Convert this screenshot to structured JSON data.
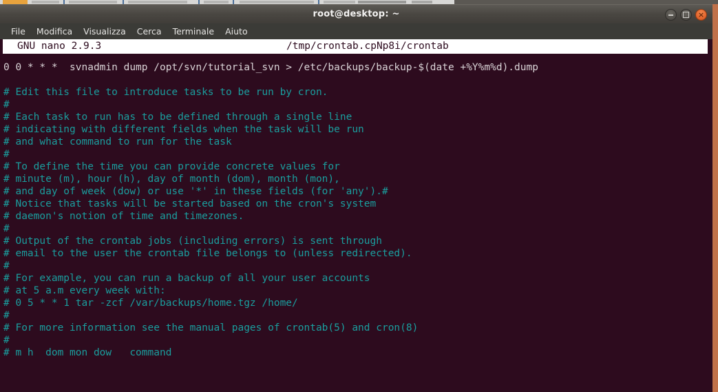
{
  "desktop": {
    "background_color": "#c0714a",
    "top_strip_color": "#d8d8d6"
  },
  "window": {
    "title": "root@desktop: ~",
    "background_color": "#2d0b1e",
    "controls": [
      {
        "name": "minimize",
        "label": "–"
      },
      {
        "name": "maximize",
        "label": "□"
      },
      {
        "name": "close",
        "label": "×"
      }
    ]
  },
  "menubar": {
    "items": [
      {
        "label": "File"
      },
      {
        "label": "Modifica"
      },
      {
        "label": "Visualizza"
      },
      {
        "label": "Cerca"
      },
      {
        "label": "Terminale"
      },
      {
        "label": "Aiuto"
      }
    ]
  },
  "nano": {
    "version_label": "GNU nano 2.9.3",
    "filename": "/tmp/crontab.cpNp8i/crontab",
    "header_bg": "#ffffff",
    "header_fg": "#2d0b1e",
    "comment_color": "#1a9e9e",
    "text_color": "#d9d3d6"
  },
  "editor": {
    "lines": [
      {
        "type": "cmd",
        "text": "0 0 * * *  svnadmin dump /opt/svn/tutorial_svn > /etc/backups/backup-$(date +%Y%m%d).dump"
      },
      {
        "type": "blank",
        "text": ""
      },
      {
        "type": "comment",
        "text": "# Edit this file to introduce tasks to be run by cron."
      },
      {
        "type": "comment",
        "text": "#"
      },
      {
        "type": "comment",
        "text": "# Each task to run has to be defined through a single line"
      },
      {
        "type": "comment",
        "text": "# indicating with different fields when the task will be run"
      },
      {
        "type": "comment",
        "text": "# and what command to run for the task"
      },
      {
        "type": "comment",
        "text": "#"
      },
      {
        "type": "comment",
        "text": "# To define the time you can provide concrete values for"
      },
      {
        "type": "comment",
        "text": "# minute (m), hour (h), day of month (dom), month (mon),"
      },
      {
        "type": "comment",
        "text": "# and day of week (dow) or use '*' in these fields (for 'any').#"
      },
      {
        "type": "comment",
        "text": "# Notice that tasks will be started based on the cron's system"
      },
      {
        "type": "comment",
        "text": "# daemon's notion of time and timezones."
      },
      {
        "type": "comment",
        "text": "#"
      },
      {
        "type": "comment",
        "text": "# Output of the crontab jobs (including errors) is sent through"
      },
      {
        "type": "comment",
        "text": "# email to the user the crontab file belongs to (unless redirected)."
      },
      {
        "type": "comment",
        "text": "#"
      },
      {
        "type": "comment",
        "text": "# For example, you can run a backup of all your user accounts"
      },
      {
        "type": "comment",
        "text": "# at 5 a.m every week with:"
      },
      {
        "type": "comment",
        "text": "# 0 5 * * 1 tar -zcf /var/backups/home.tgz /home/"
      },
      {
        "type": "comment",
        "text": "#"
      },
      {
        "type": "comment",
        "text": "# For more information see the manual pages of crontab(5) and cron(8)"
      },
      {
        "type": "comment",
        "text": "#"
      },
      {
        "type": "comment",
        "text": "# m h  dom mon dow   command"
      }
    ]
  }
}
